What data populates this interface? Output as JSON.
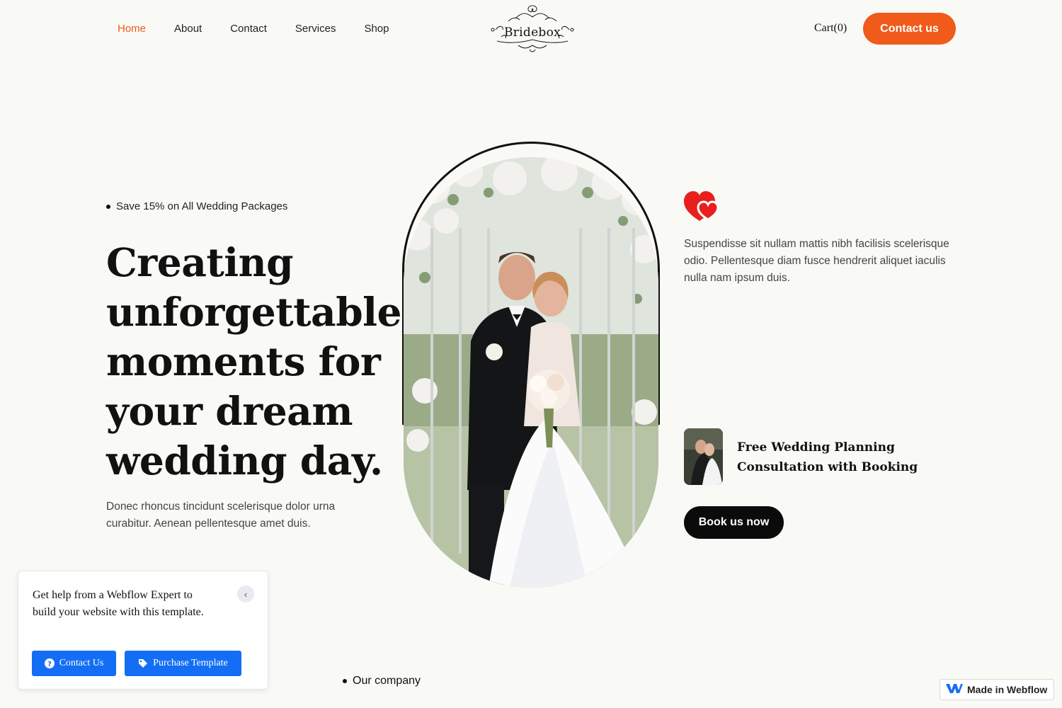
{
  "nav": {
    "links": [
      "Home",
      "About",
      "Contact",
      "Services",
      "Shop"
    ],
    "active": "Home",
    "logo_text": "Bridebox",
    "cart_label": "Cart(0)",
    "contact_label": "Contact us"
  },
  "hero": {
    "promo": "Save 15% on All Wedding Packages",
    "title": "Creating unforgettable moments for your dream wedding day.",
    "subtitle": "Donec rhoncus tincidunt scelerisque dolor urna curabitur. Aenean pellentesque amet duis."
  },
  "right": {
    "description": "Suspendisse sit nullam mattis nibh facilisis scelerisque odio. Pellentesque diam fusce hendrerit aliquet iaculis nulla nam ipsum duis.",
    "consultation_title": "Free Wedding Planning Consultation with Booking",
    "book_label": "Book us now"
  },
  "section": {
    "label": "Our company"
  },
  "help_popup": {
    "text": "Get help from a Webflow Expert to build your website with this template.",
    "contact_label": "Contact Us",
    "purchase_label": "Purchase Template"
  },
  "badge": {
    "label": "Made in Webflow"
  },
  "colors": {
    "accent": "#f05a1a",
    "background": "#f9f9f6",
    "webflow_blue": "#146ef5",
    "heart_red": "#e8201d"
  },
  "icons": [
    "ornament-logo-icon",
    "hearts-icon",
    "help-circle-icon",
    "tag-icon",
    "chevron-left-icon",
    "webflow-logo-icon"
  ]
}
